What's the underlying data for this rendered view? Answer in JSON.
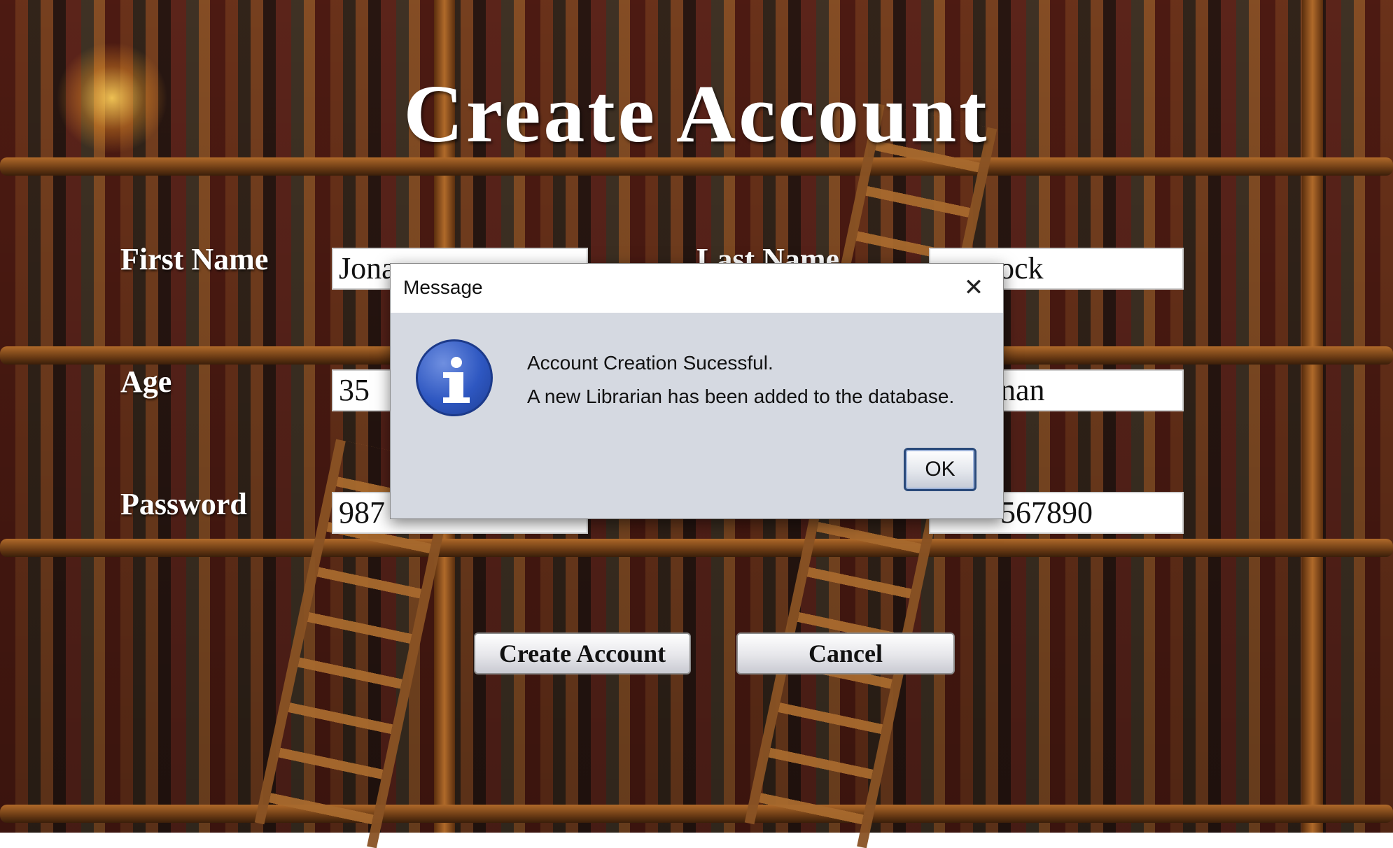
{
  "header": {
    "title": "Create Account"
  },
  "form": {
    "first_name": {
      "label": "First Name",
      "value": "Jona"
    },
    "last_name": {
      "label": "Last Name",
      "value": "ock"
    },
    "age": {
      "label": "Age",
      "value": "35"
    },
    "role": {
      "value": "nan"
    },
    "password": {
      "label": "Password",
      "value": "987"
    },
    "phone": {
      "value": "567890"
    }
  },
  "buttons": {
    "create": "Create Account",
    "cancel": "Cancel"
  },
  "dialog": {
    "title": "Message",
    "close_glyph": "✕",
    "message_line1": "Account Creation Sucessful.",
    "message_line2": "A new Librarian has been added to the database.",
    "ok": "OK",
    "icon": "info-icon"
  }
}
